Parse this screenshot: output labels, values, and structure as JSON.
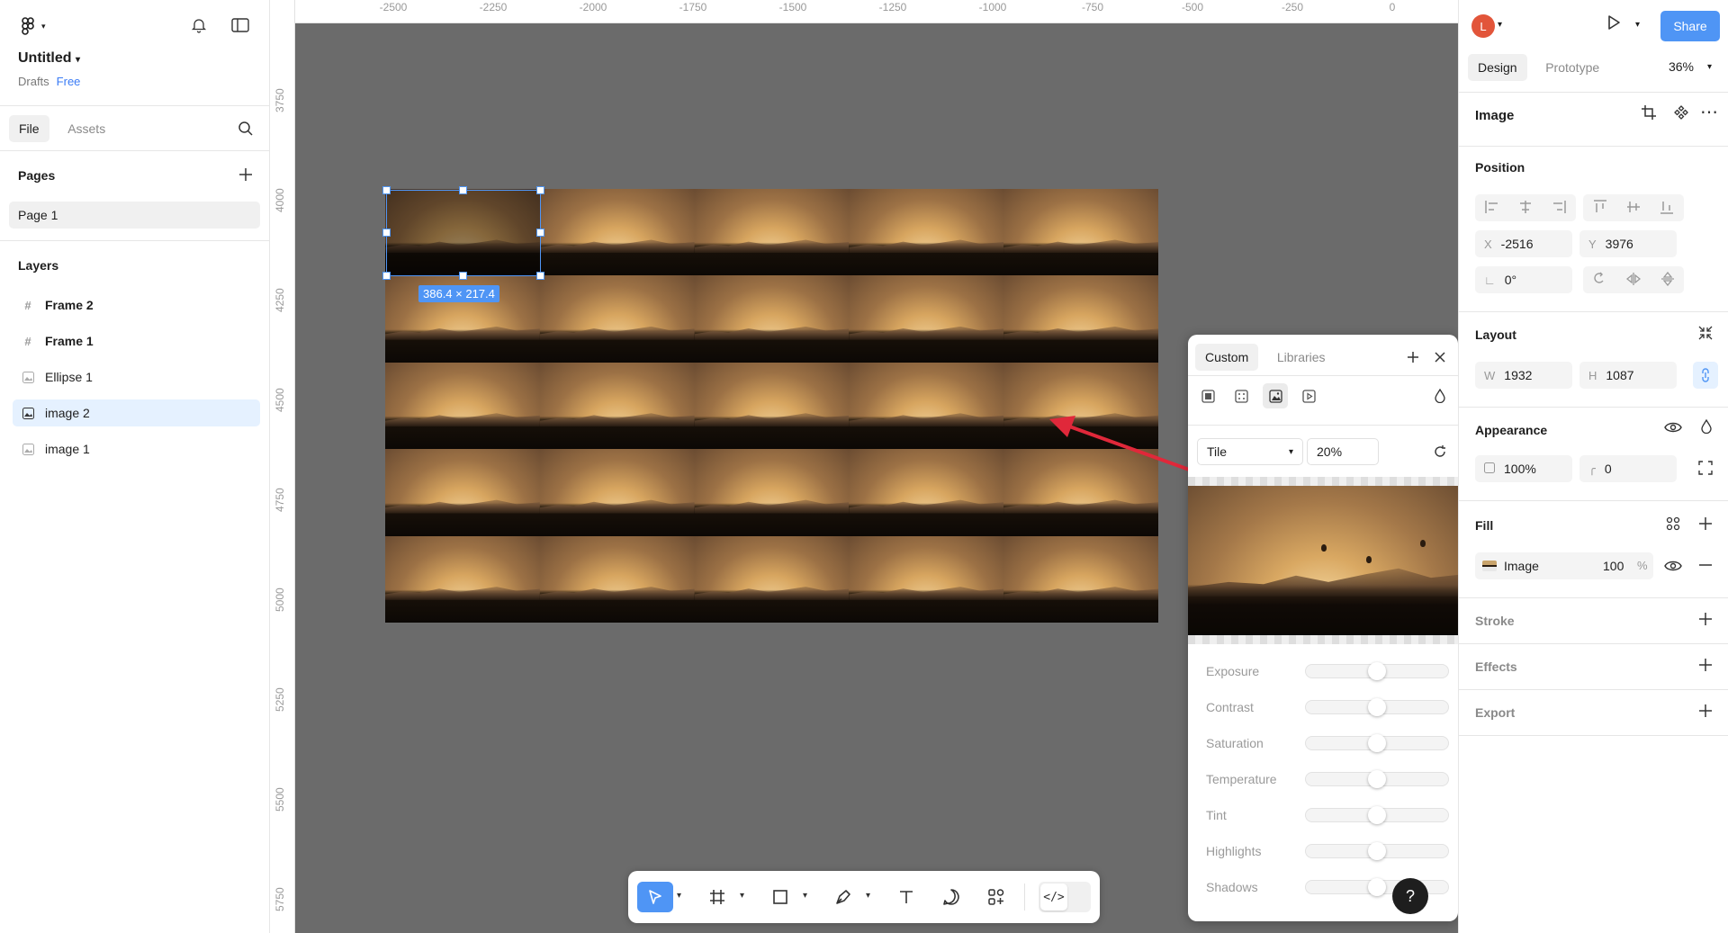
{
  "file": {
    "title": "Untitled",
    "location": "Drafts",
    "plan": "Free"
  },
  "left_tabs": {
    "file": "File",
    "assets": "Assets"
  },
  "pages": {
    "heading": "Pages",
    "items": [
      "Page 1"
    ]
  },
  "layers": {
    "heading": "Layers",
    "items": [
      {
        "label": "Frame 2",
        "icon": "frame-icon"
      },
      {
        "label": "Frame 1",
        "icon": "frame-icon"
      },
      {
        "label": "Ellipse 1",
        "icon": "image-icon"
      },
      {
        "label": "image 2",
        "icon": "image-icon",
        "selected": true
      },
      {
        "label": "image 1",
        "icon": "image-icon"
      }
    ]
  },
  "rulers": {
    "x": [
      "-2500",
      "-2250",
      "-2000",
      "-1750",
      "-1500",
      "-1250",
      "-1000",
      "-750",
      "-500",
      "-250",
      "0"
    ],
    "y": [
      "3750",
      "4000",
      "4250",
      "4500",
      "4750",
      "5000",
      "5250",
      "5500",
      "5750"
    ]
  },
  "selection": {
    "size_label": "386.4 × 217.4"
  },
  "picker": {
    "tabs": {
      "custom": "Custom",
      "libraries": "Libraries"
    },
    "fill_types": [
      "solid-fill-icon",
      "pattern-fill-icon",
      "image-fill-icon",
      "video-fill-icon"
    ],
    "mode": "Tile",
    "scale": "20%",
    "adjustments": [
      {
        "label": "Exposure",
        "value": 0.5
      },
      {
        "label": "Contrast",
        "value": 0.5
      },
      {
        "label": "Saturation",
        "value": 0.5
      },
      {
        "label": "Temperature",
        "value": 0.5
      },
      {
        "label": "Tint",
        "value": 0.5
      },
      {
        "label": "Highlights",
        "value": 0.5
      },
      {
        "label": "Shadows",
        "value": 0.5
      }
    ]
  },
  "toolbar": {
    "tools": [
      "move-tool",
      "frame-tool",
      "rectangle-tool",
      "pen-tool",
      "text-tool",
      "comment-tool",
      "actions-tool"
    ],
    "dev_mode": "</>"
  },
  "help": "?",
  "right": {
    "avatar": "L",
    "share": "Share",
    "tabs": {
      "design": "Design",
      "prototype": "Prototype"
    },
    "zoom": "36%",
    "title": "Image",
    "position": {
      "heading": "Position",
      "x_key": "X",
      "x": "-2516",
      "y_key": "Y",
      "y": "3976",
      "rotation": "0°"
    },
    "layout": {
      "heading": "Layout",
      "w_key": "W",
      "w": "1932",
      "h_key": "H",
      "h": "1087"
    },
    "appearance": {
      "heading": "Appearance",
      "opacity": "100%",
      "radius": "0"
    },
    "fill": {
      "heading": "Fill",
      "type": "Image",
      "opacity": "100",
      "unit": "%"
    },
    "stroke": "Stroke",
    "effects": "Effects",
    "export": "Export"
  },
  "colors": {
    "accent": "#4f95f5",
    "canvas": "#6b6b6b",
    "arrow": "#e0283a",
    "avatar": "#e2553a"
  }
}
